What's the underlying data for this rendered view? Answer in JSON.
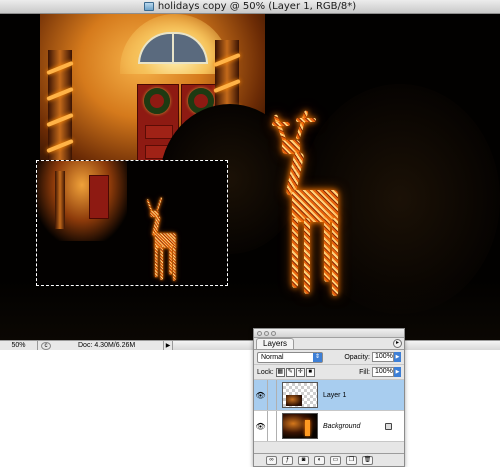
{
  "window": {
    "title": "holidays copy @ 50% (Layer 1, RGB/8*)"
  },
  "status": {
    "zoom": "50%",
    "doc_size": "Doc: 4.30M/6.26M"
  },
  "layers_panel": {
    "tab_label": "Layers",
    "blend_mode": "Normal",
    "opacity_label": "Opacity:",
    "opacity_value": "100%",
    "lock_label": "Lock:",
    "fill_label": "Fill:",
    "fill_value": "100%",
    "layers": [
      {
        "name": "Layer 1",
        "selected": true
      },
      {
        "name": "Background",
        "selected": false
      }
    ],
    "footer_icons": [
      "link-icon",
      "layer-style-icon",
      "mask-icon",
      "adjustment-icon",
      "group-icon",
      "new-layer-icon",
      "trash-icon"
    ]
  },
  "colors": {
    "selection_highlight": "#a8cdef",
    "accent_blue": "#3d7fd6",
    "light_glow": "#ff9a22"
  }
}
